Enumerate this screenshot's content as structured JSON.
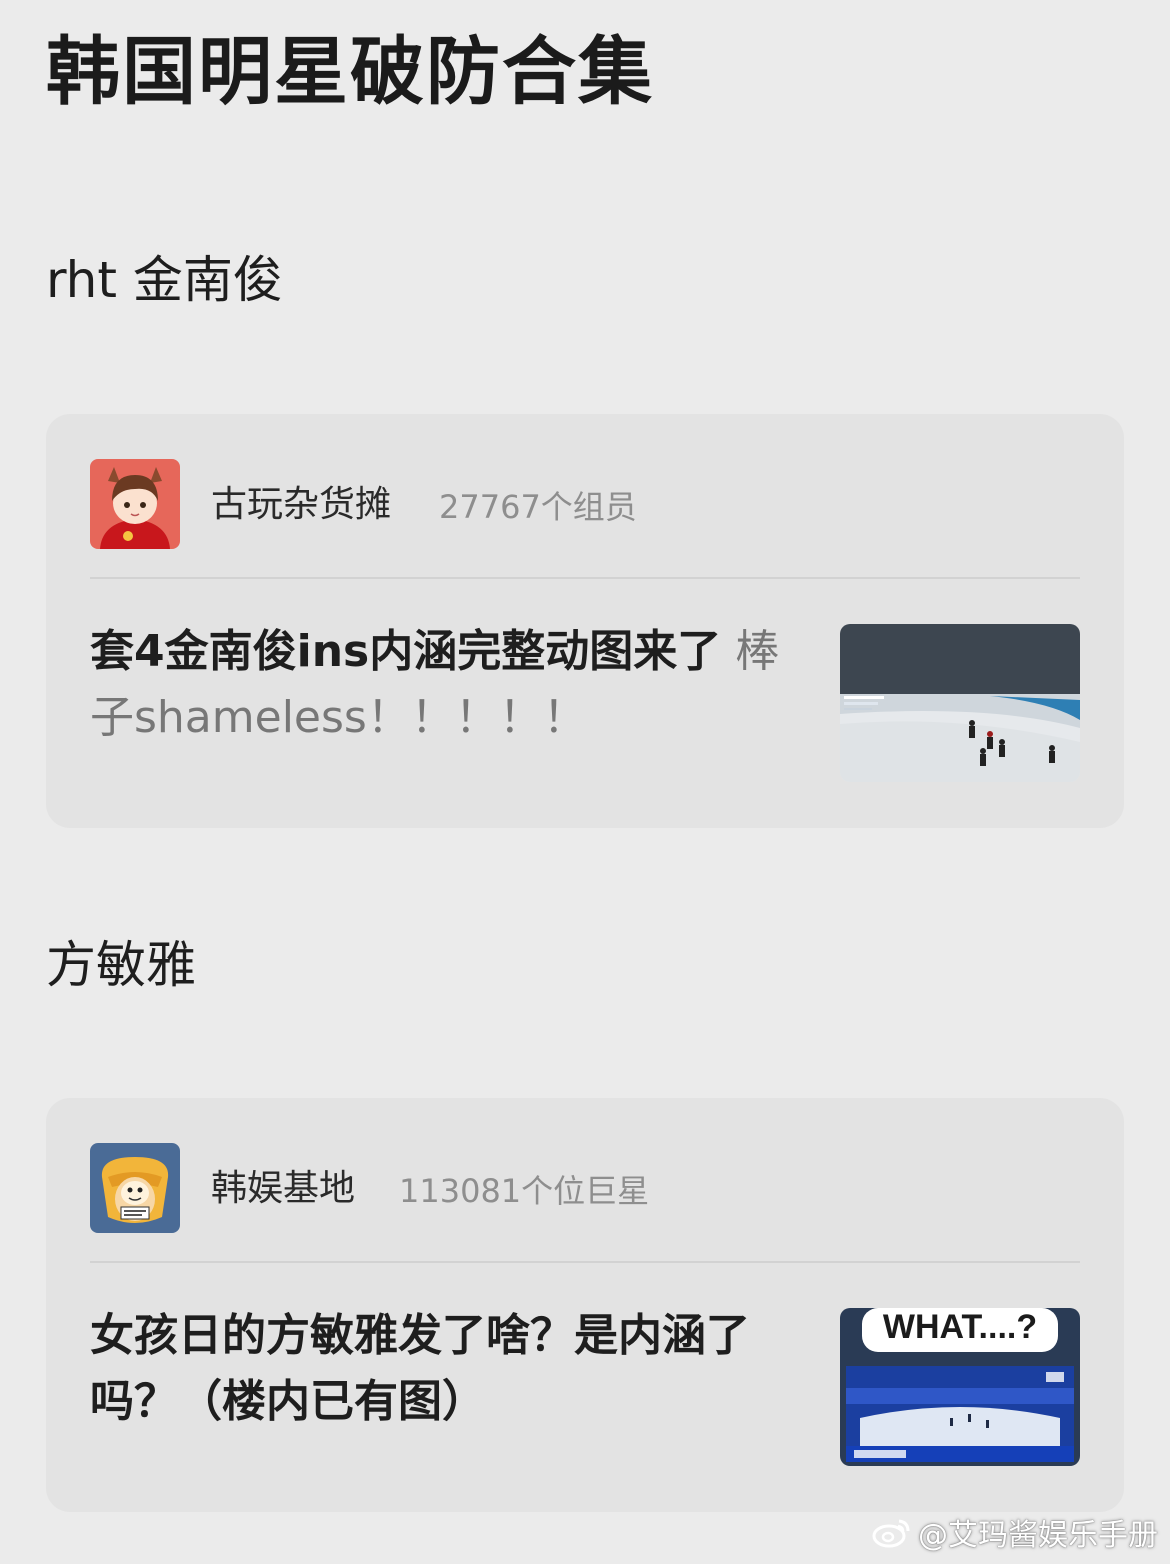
{
  "page": {
    "title": "韩国明星破防合集"
  },
  "sections": [
    {
      "heading": "rht 金南俊",
      "card": {
        "group_name": "古玩杂货摊",
        "member_count": "27767个组员",
        "post_bold": "套4金南俊ins内涵完整动图来了",
        "post_grey": " 棒子shameless！！！！！",
        "thumbnail": "speed-skating-race-image"
      }
    },
    {
      "heading": "方敏雅",
      "card": {
        "group_name": "韩娱基地",
        "member_count": "113081个位巨星",
        "post_bold": "女孩日的方敏雅发了啥？是内涵了吗？（楼内已有图）",
        "post_grey": "",
        "thumbnail_caption": "WHAT....?"
      }
    }
  ],
  "watermark": {
    "text": "@艾玛酱娱乐手册",
    "icon": "weibo-icon"
  },
  "colors": {
    "background": "#ebebeb",
    "card": "#e3e3e3",
    "muted_text": "#8e8e8e",
    "avatar1_bg": "#e6675a",
    "avatar2_bg": "#4a6b96"
  }
}
